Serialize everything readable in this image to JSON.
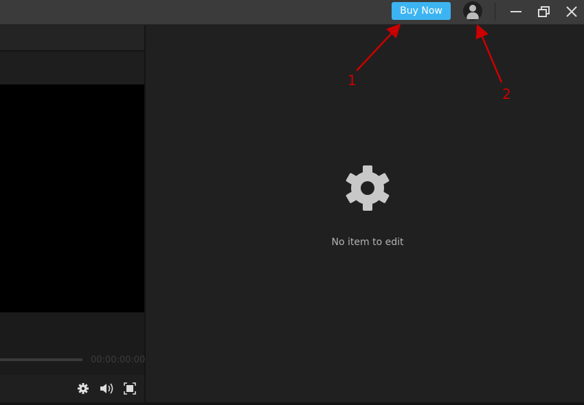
{
  "titlebar": {
    "buy_label": "Buy Now",
    "accent": "#3db4f2"
  },
  "player": {
    "timecode": "00:00:00:00"
  },
  "editor": {
    "empty_text": "No item to edit"
  },
  "annotations": {
    "label1": "1",
    "label2": "2",
    "color": "#cc0000"
  }
}
